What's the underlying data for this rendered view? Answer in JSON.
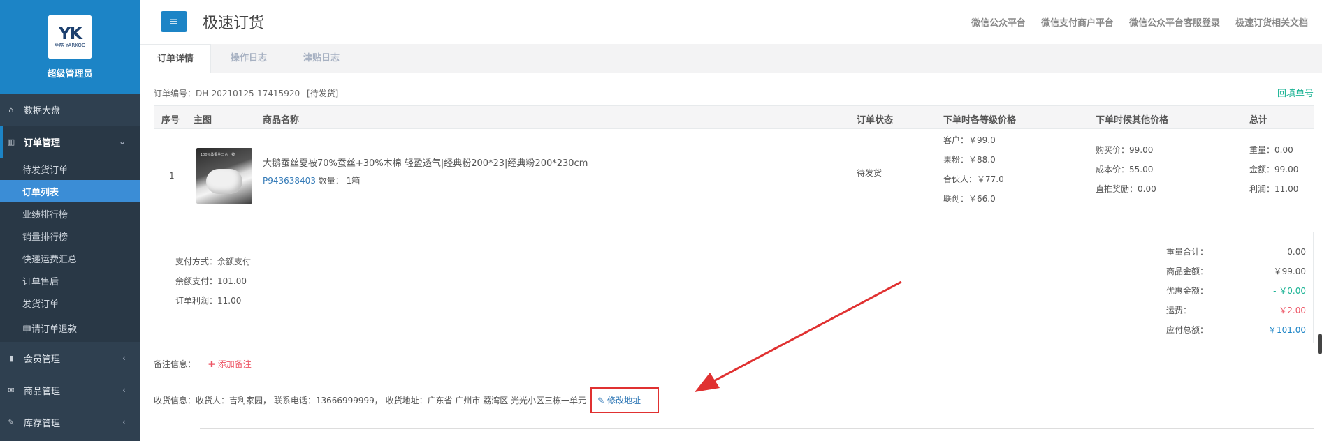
{
  "brand": {
    "logo_mark": "YK",
    "logo_sub": "至酷 YARKOO",
    "role": "超级管理员"
  },
  "sidebar": {
    "items": [
      {
        "label": "数据大盘",
        "icon": "home-icon"
      },
      {
        "label": "订单管理",
        "icon": "columns-icon",
        "open": true,
        "sub": [
          "待发货订单",
          "订单列表",
          "业绩排行榜",
          "销量排行榜",
          "快递运费汇总",
          "订单售后",
          "发货订单",
          "申请订单退款"
        ],
        "active_sub": "订单列表"
      },
      {
        "label": "会员管理",
        "icon": "bar-chart-icon"
      },
      {
        "label": "商品管理",
        "icon": "envelope-icon"
      },
      {
        "label": "库存管理",
        "icon": "edit-icon"
      }
    ],
    "sub": [
      "待发货订单",
      "订单列表",
      "业绩排行榜",
      "销量排行榜",
      "快递运费汇总",
      "订单售后",
      "发货订单",
      "申请订单退款"
    ]
  },
  "header": {
    "menu_icon": "≡",
    "title": "极速订货",
    "links": [
      "微信公众平台",
      "微信支付商户平台",
      "微信公众平台客服登录",
      "极速订货相关文档"
    ]
  },
  "tabs": [
    "订单详情",
    "操作日志",
    "津贴日志"
  ],
  "order": {
    "number_label": "订单编号：",
    "number": "DH-20210125-17415920",
    "status_tag": "[待发货]",
    "refill": "回填单号"
  },
  "table": {
    "headers": [
      "序号",
      "主图",
      "商品名称",
      "订单状态",
      "下单时各等级价格",
      "下单时候其他价格",
      "总计"
    ],
    "rows": [
      {
        "index": "1",
        "image_caption": "100%桑蚕丝二合一被",
        "name": "大鹅蚕丝夏被70%蚕丝+30%木棉 轻盈透气|经典粉200*23|经典粉200*230cm",
        "sku": "P943638403",
        "qty_label": "数量：",
        "qty": "1箱",
        "status": "待发货",
        "level_prices": [
          "客户：￥99.0",
          "果粉：￥88.0",
          "合伙人：￥77.0",
          "联创：￥66.0"
        ],
        "other_prices": [
          "购买价：99.00",
          "成本价：55.00",
          "直推奖励：0.00"
        ],
        "totals": [
          "重量：0.00",
          "金额：99.00",
          "利润：11.00"
        ]
      }
    ]
  },
  "payment": [
    "支付方式：余额支付",
    "余额支付：101.00",
    "订单利润：11.00"
  ],
  "summary": [
    {
      "label": "重量合计：",
      "value": "0.00",
      "color": "#555555"
    },
    {
      "label": "商品金额：",
      "value": "￥99.00",
      "color": "#555555"
    },
    {
      "label": "优惠金额：",
      "value": "- ￥0.00",
      "color": "#1ab394"
    },
    {
      "label": "运费：",
      "value": "￥2.00",
      "color": "#ed5565"
    },
    {
      "label": "应付总额：",
      "value": "￥101.00",
      "color": "#1c84c6"
    }
  ],
  "remark": {
    "label": "备注信息：",
    "add": "添加备注"
  },
  "shipping": {
    "text": "收货信息：收货人：吉利家园，  联系电话：13666999999，  收货地址：广东省 广州市 荔湾区 光光小区三栋一单元",
    "edit": "修改地址"
  },
  "colors": {
    "primary": "#1c84c6",
    "sidebar": "#2f4050",
    "highlight": "#e03131"
  }
}
